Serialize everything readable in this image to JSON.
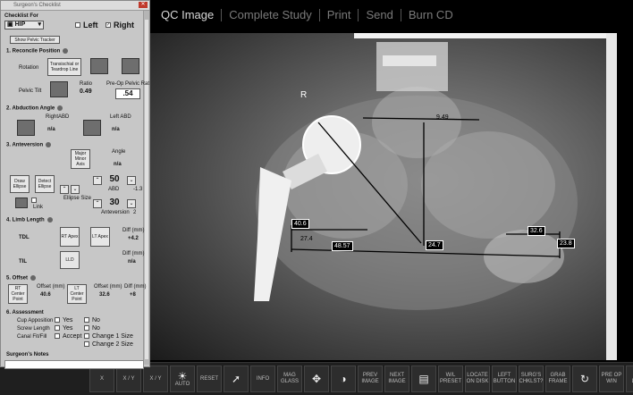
{
  "topmenu": [
    "QC Image",
    "Complete Study",
    "Print",
    "Send",
    "Burn CD"
  ],
  "panel": {
    "title": "Surgeon's Checklist",
    "checklist_for": "Checklist For",
    "procedure": "HIP",
    "left_label": "Left",
    "right_label": "Right",
    "show_tracker": "Show Pelvic Tracker",
    "s1": "1. Reconcile Position",
    "rotation": "Rotation",
    "transischial": "Transischial or Teardrop Line",
    "pelvic_tilt": "Pelvic Tilt",
    "ratio_label": "Ratio",
    "ratio_value": "0.49",
    "preop_label": "Pre-Op Pelvic Rat",
    "preop_value": ".54",
    "s2": "2. Abduction Angle",
    "right_abd": "RightABD",
    "left_abd": "Left ABD",
    "na": "n/a",
    "s3": "3. Anteversion",
    "major_minor": "Major Minor Axis",
    "angle": "Angle",
    "draw_ellipse": "Draw Ellipse",
    "detect_ellipse": "Detect Ellipse",
    "link": "Link",
    "ellipse_size": "Ellipse Size",
    "abd_value": "50",
    "abd_label": "ABD",
    "abd_delta": "-1.3",
    "antev_value": "30",
    "antev_label": "Anteversion",
    "antev_delta": "2",
    "s4": "4. Limb Length",
    "tdl": "TDL",
    "til": "TIL",
    "rt_apex": "RT Apex",
    "lt_apex": "LT Apex",
    "lld": "LLD",
    "diff_mm": "Diff (mm)",
    "tdl_diff": "+4.2",
    "til_diff": "n/a",
    "s5": "5. Offset",
    "rt_center": "RT Center Point",
    "lt_center": "LT Center Point",
    "offset_mm": "Offset (mm)",
    "offset_rt": "40.6",
    "offset_lt": "32.6",
    "offset_diff": "+8",
    "s6": "6. Assessment",
    "cup_app": "Cup Apposition",
    "screw_len": "Screw Length",
    "canal": "Canal Fit/Fill",
    "yes": "Yes",
    "no": "No",
    "accept": "Accept",
    "change1": "Change 1 Size",
    "change2": "Change 2 Size",
    "notes": "Surgeon's Notes"
  },
  "xray": {
    "side_marker": "R",
    "measurements": [
      "9.49",
      "40.6",
      "32.6",
      "24.7",
      "48.57",
      "23.8",
      "27.4"
    ]
  },
  "toolbar": [
    {
      "label": "X",
      "icon": ""
    },
    {
      "label": "X / Y",
      "icon": ""
    },
    {
      "label": "X / Y",
      "icon": ""
    },
    {
      "label": "AUTO",
      "icon": "sun-icon"
    },
    {
      "label": "RESET",
      "icon": ""
    },
    {
      "label": "",
      "icon": "cursor-icon"
    },
    {
      "label": "INFO",
      "icon": ""
    },
    {
      "label": "MAG GLASS",
      "icon": ""
    },
    {
      "label": "",
      "icon": "pan-icon"
    },
    {
      "label": "",
      "icon": "contrast-icon"
    },
    {
      "label": "PREV IMAGE",
      "icon": ""
    },
    {
      "label": "NEXT IMAGE",
      "icon": ""
    },
    {
      "label": "",
      "icon": "dicom-icon"
    },
    {
      "label": "W/L PRESET",
      "icon": ""
    },
    {
      "label": "LOCATE ON DISK",
      "icon": ""
    },
    {
      "label": "LEFT BUTTON",
      "icon": ""
    },
    {
      "label": "SURG'S CHKLST?",
      "icon": ""
    },
    {
      "label": "GRAB FRAME",
      "icon": ""
    },
    {
      "label": "",
      "icon": "rotate-icon"
    },
    {
      "label": "PRE OP WIN",
      "icon": ""
    },
    {
      "label": "DEL LAST",
      "icon": ""
    }
  ]
}
